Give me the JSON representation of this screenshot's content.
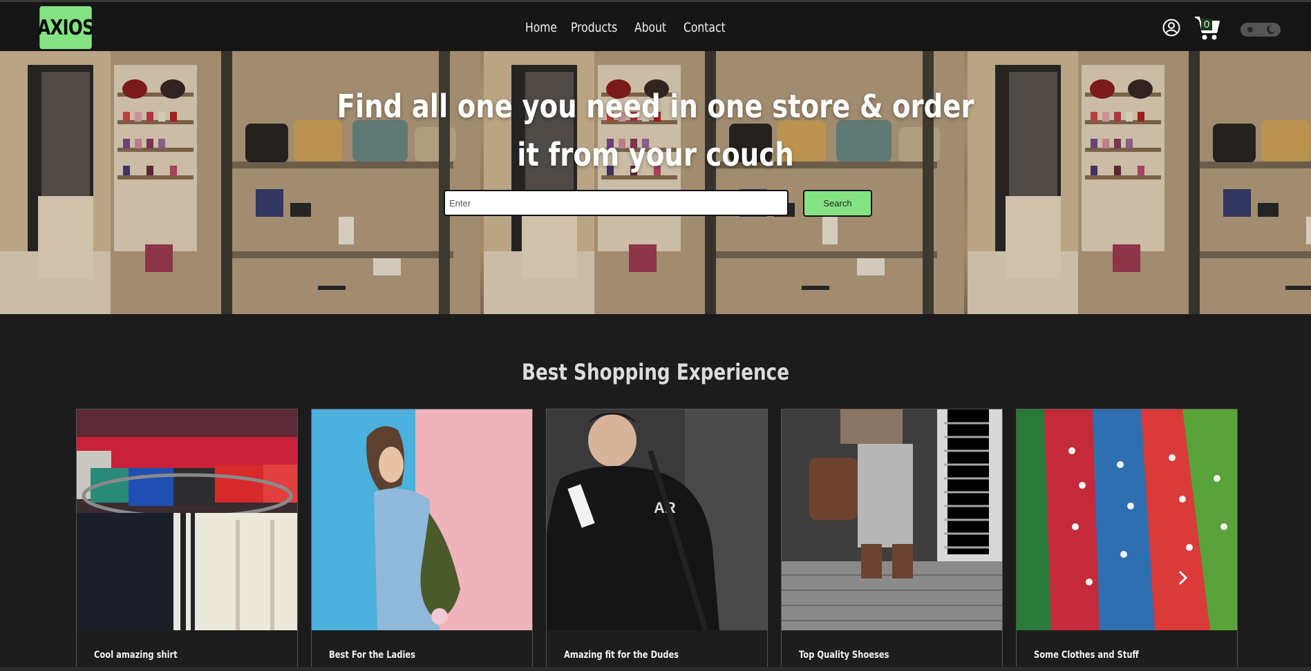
{
  "header": {
    "logo": "AXIOS",
    "nav": [
      "Home",
      "Products",
      "About",
      "Contact"
    ],
    "cart_count": "0"
  },
  "hero": {
    "title_line1": "Find all one you need in one store & order",
    "title_line2": "it from your couch",
    "search_placeholder": "Enter",
    "search_label": "Search"
  },
  "section": {
    "title": "Best Shopping Experience"
  },
  "cards": [
    {
      "caption": "Cool amazing shirt"
    },
    {
      "caption": "Best For the Ladies"
    },
    {
      "caption": "Amazing fit for the Dudes"
    },
    {
      "caption": "Top Quality Shoeses"
    },
    {
      "caption": "Some Clothes and Stuff"
    }
  ],
  "colors": {
    "accent": "#86e383",
    "background": "#1c1c1c",
    "header": "#161616"
  }
}
